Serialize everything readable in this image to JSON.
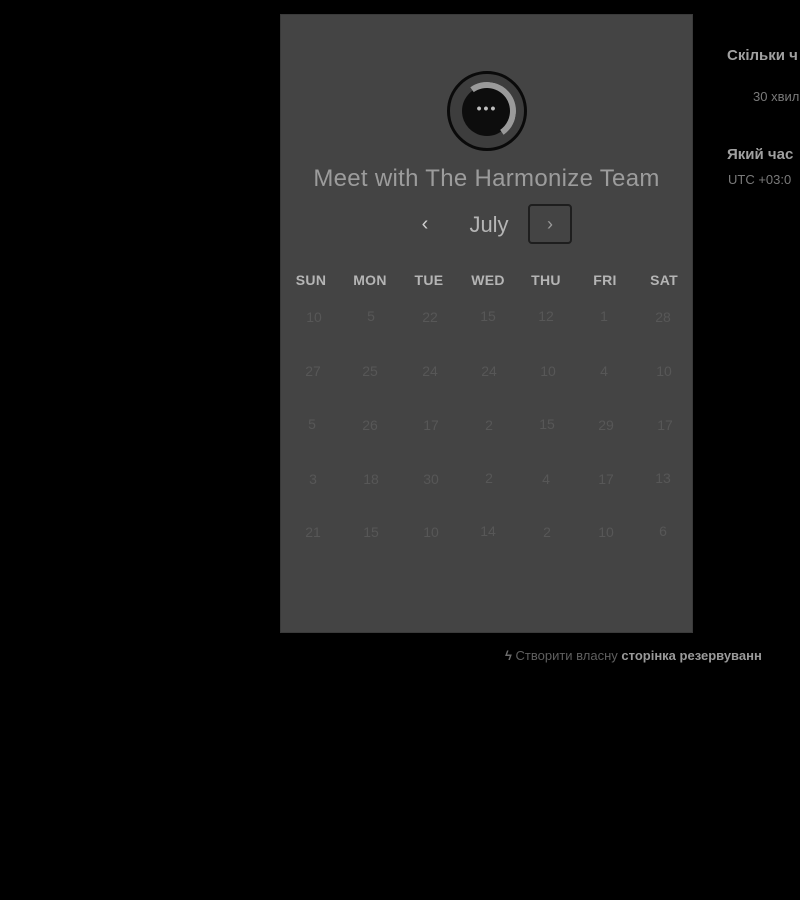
{
  "card": {
    "logo_glyph": "•••",
    "title": "Meet with The Harmonize Team",
    "month": "July",
    "prev_glyph": "‹",
    "next_glyph": "›"
  },
  "weekdays": [
    "SUN",
    "MON",
    "TUE",
    "WED",
    "THU",
    "FRI",
    "SAT"
  ],
  "days": [
    [
      "10",
      "5",
      "22",
      "15",
      "12",
      "1",
      "28"
    ],
    [
      "27",
      "25",
      "24",
      "24",
      "10",
      "4",
      "10"
    ],
    [
      "5",
      "26",
      "17",
      "2",
      "15",
      "29",
      "17"
    ],
    [
      "3",
      "18",
      "30",
      "2",
      "4",
      "17",
      "13"
    ],
    [
      "21",
      "15",
      "10",
      "14",
      "2",
      "10",
      "6"
    ]
  ],
  "side": {
    "duration_heading": "Скільки ч",
    "duration_value": "30 хвил",
    "time_heading": "Який час",
    "timezone": "UTC +03:0"
  },
  "footer": {
    "icon_glyph": "ϟ",
    "text": "Створити власну",
    "bold": "сторінка резервуванн"
  }
}
